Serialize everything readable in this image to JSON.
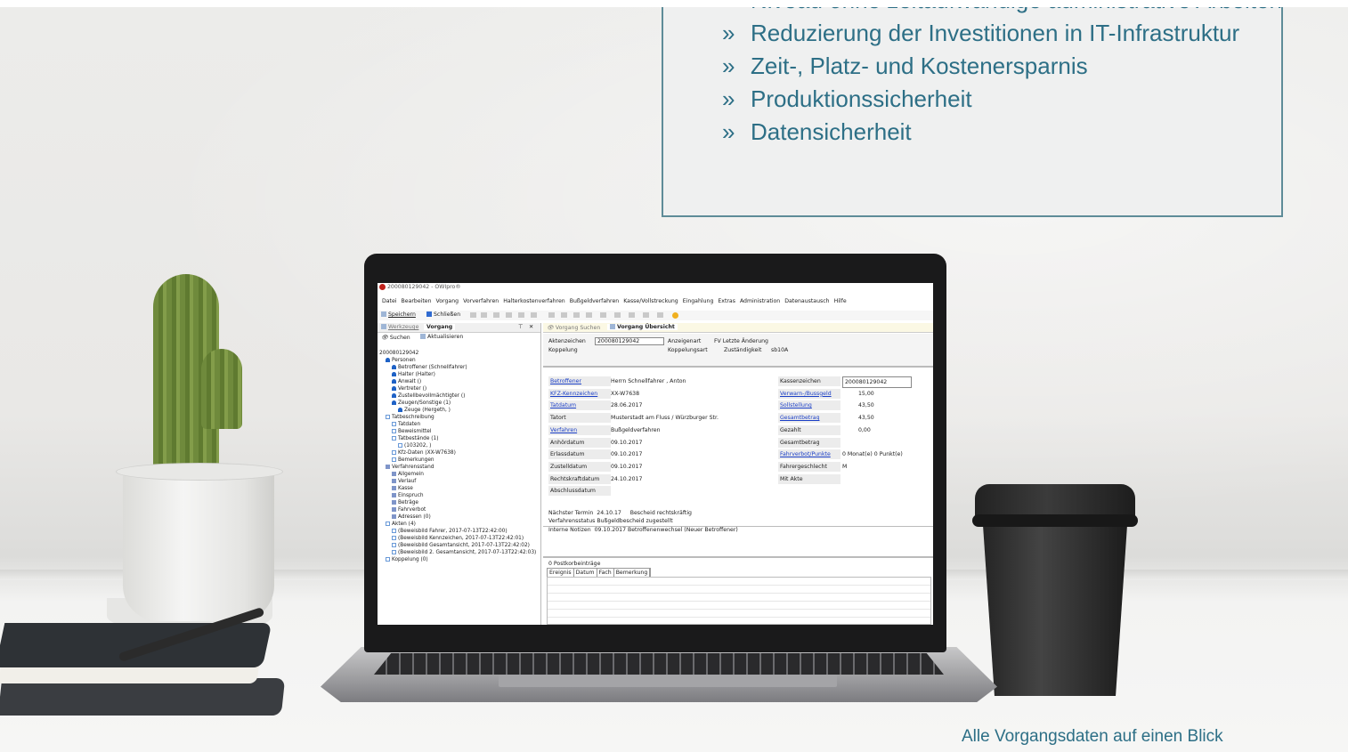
{
  "marketing": {
    "bullet_symbol": "»",
    "bullets": [
      "Niveau ohne zeitaufwändige administrative Arbeiten",
      "Reduzierung der Investitionen in IT-Infrastruktur",
      "Zeit-, Platz- und Kostenersparnis",
      "Produktionssicherheit",
      "Datensicherheit"
    ],
    "caption": "Alle Vorgangsdaten auf einen Blick",
    "accent_color": "#2d6f86"
  },
  "app": {
    "window_title": "200080129042 - OWIpro®",
    "menu": [
      "Datei",
      "Bearbeiten",
      "Vorgang",
      "Vorverfahren",
      "Halterkostenverfahren",
      "Bußgeldverfahren",
      "Kasse/Vollstreckung",
      "Eingahlung",
      "Extras",
      "Administration",
      "Datenaustausch",
      "Hilfe"
    ],
    "toolbar": {
      "save": "Speichern",
      "close": "Schließen"
    },
    "left_tabs": {
      "tools": "Werkzeuge",
      "case": "Vorgang"
    },
    "left_tools": {
      "search": "Suchen",
      "refresh": "Aktualisieren"
    },
    "tree": [
      {
        "label": "200080129042",
        "icon": "none",
        "indent": 0
      },
      {
        "label": "Personen",
        "icon": "person-icon",
        "indent": 1
      },
      {
        "label": "Betroffener (Schnellfahrer)",
        "icon": "person-icon",
        "indent": 2
      },
      {
        "label": "Halter (Halter)",
        "icon": "person-icon",
        "indent": 2
      },
      {
        "label": "Anwalt ()",
        "icon": "person-icon",
        "indent": 2
      },
      {
        "label": "Vertreter ()",
        "icon": "person-icon",
        "indent": 2
      },
      {
        "label": "Zustellbevollmächtigter ()",
        "icon": "person-icon",
        "indent": 2
      },
      {
        "label": "Zeugen/Sonstige (1)",
        "icon": "person-icon",
        "indent": 2
      },
      {
        "label": "Zeuge (Hergeth, )",
        "icon": "person-icon",
        "indent": 3
      },
      {
        "label": "Tatbeschreibung",
        "icon": "document-icon",
        "indent": 1
      },
      {
        "label": "Tatdaten",
        "icon": "document-icon",
        "indent": 2
      },
      {
        "label": "Beweismittel",
        "icon": "document-icon",
        "indent": 2
      },
      {
        "label": "Tatbestände (1)",
        "icon": "document-icon",
        "indent": 2
      },
      {
        "label": "(103202, )",
        "icon": "document-icon",
        "indent": 3
      },
      {
        "label": "Kfz-Daten (XX-W7638)",
        "icon": "document-icon",
        "indent": 2
      },
      {
        "label": "Bemerkungen",
        "icon": "document-icon",
        "indent": 2
      },
      {
        "label": "Verfahrensstand",
        "icon": "grid-icon",
        "indent": 1
      },
      {
        "label": "Allgemein",
        "icon": "grid-icon",
        "indent": 2
      },
      {
        "label": "Verlauf",
        "icon": "grid-icon",
        "indent": 2
      },
      {
        "label": "Kasse",
        "icon": "grid-icon",
        "indent": 2
      },
      {
        "label": "Einspruch",
        "icon": "grid-icon",
        "indent": 2
      },
      {
        "label": "Beträge",
        "icon": "grid-icon",
        "indent": 2
      },
      {
        "label": "Fahrverbot",
        "icon": "grid-icon",
        "indent": 2
      },
      {
        "label": "Adressen (0)",
        "icon": "grid-icon",
        "indent": 2
      },
      {
        "label": "Akten (4)",
        "icon": "document-icon",
        "indent": 1
      },
      {
        "label": "(Beweisbild Fahrer, 2017-07-13T22:42:00)",
        "icon": "document-icon",
        "indent": 2
      },
      {
        "label": "(Beweisbild Kennzeichen, 2017-07-13T22:42:01)",
        "icon": "document-icon",
        "indent": 2
      },
      {
        "label": "(Beweisbild Gesamtansicht, 2017-07-13T22:42:02)",
        "icon": "document-icon",
        "indent": 2
      },
      {
        "label": "(Beweisbild 2. Gesamtansicht, 2017-07-13T22:42:03)",
        "icon": "document-icon",
        "indent": 2
      },
      {
        "label": "Koppelung (0)",
        "icon": "document-icon",
        "indent": 1
      }
    ],
    "right_tabs": {
      "search": "Vorgang Suchen",
      "overview": "Vorgang Übersicht"
    },
    "header": {
      "aktenzeichen_label": "Aktenzeichen",
      "aktenzeichen_value": "200080129042",
      "anzeigenart_label": "Anzeigenart",
      "anzeigenart_value": "FV Letzte Änderung",
      "koppelung_label": "Koppelung",
      "koppelungsart_label": "Koppelungsart",
      "zustaendigkeit_label": "Zuständigkeit",
      "zustaendigkeit_value": "sb10A"
    },
    "left_fields": [
      {
        "label": "Betroffener",
        "link": true,
        "value": "Herrn Schnellfahrer , Anton"
      },
      {
        "label": "KFZ-Kennzeichen",
        "link": true,
        "value": "XX-W7638"
      },
      {
        "label": "Tatdatum",
        "link": true,
        "value": "28.06.2017"
      },
      {
        "label": "Tatort",
        "link": false,
        "value": "Musterstadt am Fluss / Würzburger Str."
      },
      {
        "label": "Verfahren",
        "link": true,
        "value": "Bußgeldverfahren"
      },
      {
        "label": "Anhördatum",
        "link": false,
        "value": "09.10.2017"
      },
      {
        "label": "Erlassdatum",
        "link": false,
        "value": "09.10.2017"
      },
      {
        "label": "Zustelldatum",
        "link": false,
        "value": "09.10.2017"
      },
      {
        "label": "Rechtskraftdatum",
        "link": false,
        "value": "24.10.2017"
      },
      {
        "label": "Abschlussdatum",
        "link": false,
        "value": ""
      }
    ],
    "right_fields": [
      {
        "label": "Kassenzeichen",
        "link": false,
        "value": "200080129042"
      },
      {
        "label": "Verwarn-/Bussgeld",
        "link": true,
        "value": "15,00"
      },
      {
        "label": "Sollstellung",
        "link": true,
        "value": "43,50"
      },
      {
        "label": "Gesamtbetrag",
        "link": true,
        "value": "43,50"
      },
      {
        "label": "Gezahlt",
        "link": false,
        "value": "0,00"
      },
      {
        "label": "Gesamtbetrag bezahlt",
        "link": false,
        "value": ""
      },
      {
        "label": "Fahrverbot/Punkte",
        "link": true,
        "value": "0 Monat(e) 0 Punkt(e)"
      },
      {
        "label": "Fahrergeschlecht",
        "link": false,
        "value": "M"
      },
      {
        "label": "Mit Akte",
        "link": false,
        "value": ""
      }
    ],
    "status": {
      "next_term_label": "Nächster Termin",
      "next_term_date": "24.10.17",
      "next_term_text": "Bescheid rechtskräftig",
      "state_label": "Verfahrensstatus",
      "state_value": "Bußgeldbescheid zugestellt",
      "notes_label": "Interne Notizen",
      "notes_value": "09.10.2017 Betroffenenwechsel (Neuer Betroffener)"
    },
    "postbox": {
      "title": "0 Postkorbeinträge",
      "columns": [
        "Ereignis",
        "Datum",
        "Fach",
        "Bemerkung"
      ]
    }
  }
}
